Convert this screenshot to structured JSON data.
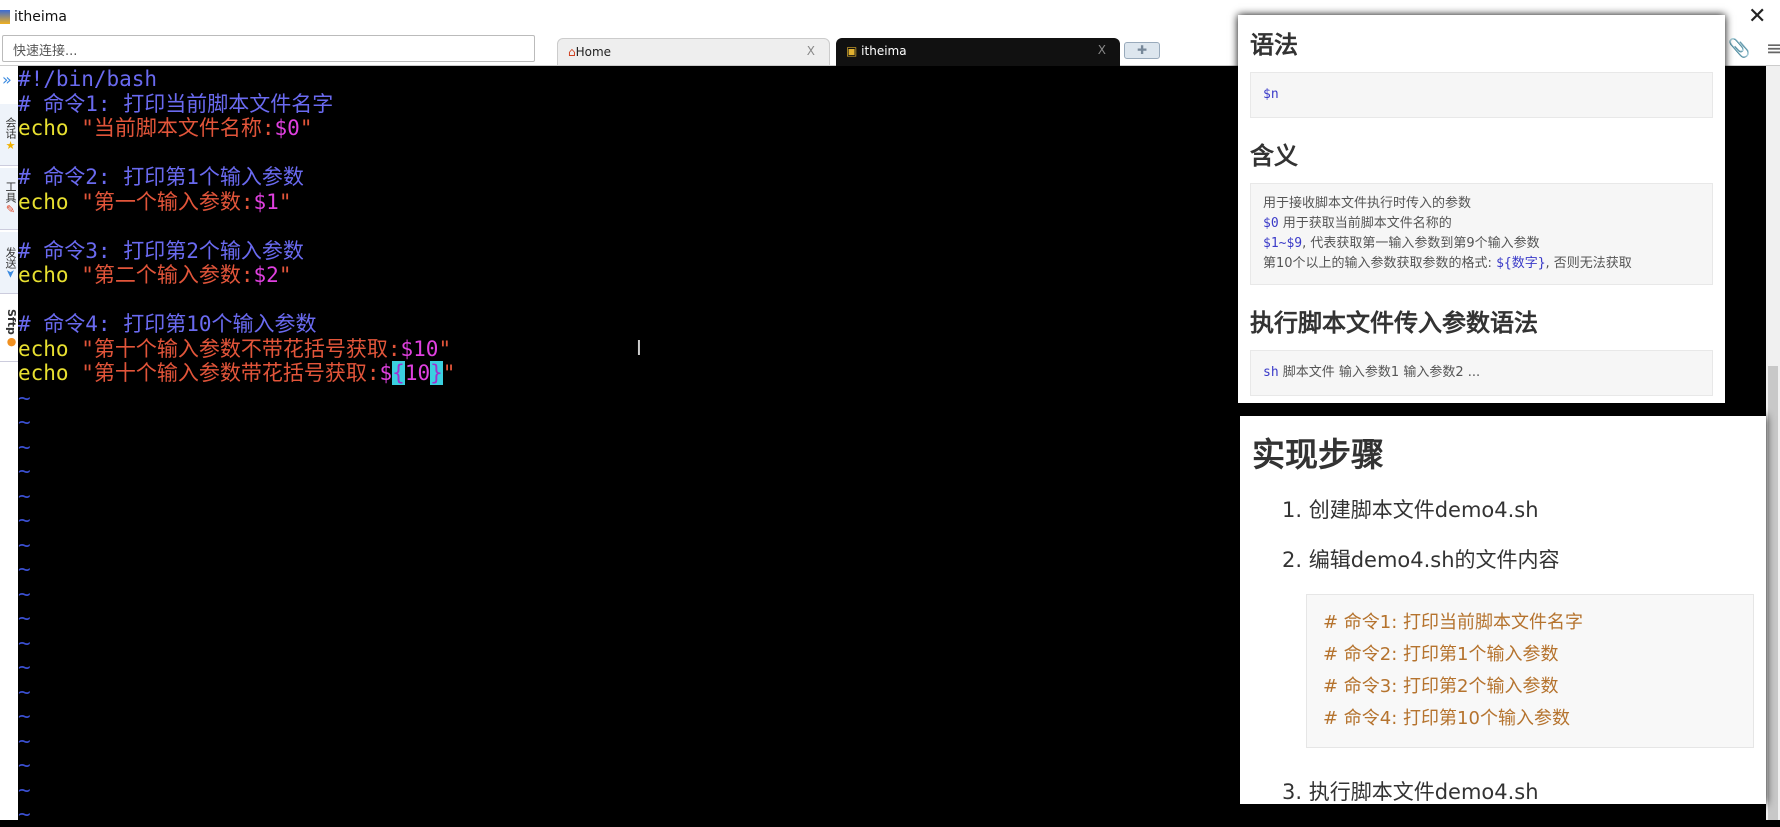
{
  "window": {
    "title": "itheima",
    "close_icon": "close-icon"
  },
  "toolbar": {
    "quick_connect_placeholder": "快速连接..."
  },
  "tabs": [
    {
      "label": "Home",
      "close": "X"
    },
    {
      "label": "itheima",
      "close": "X"
    }
  ],
  "new_tab": "✚",
  "sidebar": {
    "toggle": "»",
    "items": [
      "会话",
      "工具",
      "发送",
      "Sftp"
    ]
  },
  "terminal": {
    "shebang": "#!/bin/bash",
    "c1": "# 命令1: 打印当前脚本文件名字",
    "e1a": "echo",
    "e1b": " \"当前脚本文件名称:",
    "e1c": "$0",
    "e1d": "\"",
    "c2": "# 命令2: 打印第1个输入参数",
    "e2b": " \"第一个输入参数:",
    "e2c": "$1",
    "c3": "# 命令3: 打印第2个输入参数",
    "e3b": " \"第二个输入参数:",
    "e3c": "$2",
    "c4": "# 命令4: 打印第10个输入参数",
    "e4b": " \"第十个输入参数不带花括号获取:",
    "e4c": "$10",
    "e5b": " \"第十个输入参数带花括号获取:",
    "e5c": "$",
    "e5d": "{",
    "e5e": "10",
    "e5f": "}",
    "tilde": "~"
  },
  "note1": {
    "h_syntax": "语法",
    "syntax_code": "$n",
    "h_meaning": "含义",
    "m1": "用于接收脚本文件执行时传入的参数",
    "m2_code": "$0",
    "m2": " 用于获取当前脚本文件名称的",
    "m3_code": "$1~$9",
    "m3": ", 代表获取第一输入参数到第9个输入参数",
    "m4": "第10个以上的输入参数获取参数的格式: ",
    "m4_code": "${数字}",
    "m4_tail": ", 否则无法获取",
    "h_exec": "执行脚本文件传入参数语法",
    "exec_code": "sh",
    "exec_rest": " 脚本文件  输入参数1  输入参数2 ..."
  },
  "note2": {
    "h": "实现步骤",
    "steps": [
      "1. 创建脚本文件demo4.sh",
      "2. 编辑demo4.sh的文件内容",
      "3. 执行脚本文件demo4.sh"
    ],
    "code": [
      "#  命令1:  打印当前脚本文件名字",
      "#  命令2:  打印第1个输入参数",
      "#  命令3:  打印第2个输入参数",
      "#  命令4:  打印第10个输入参数"
    ]
  }
}
